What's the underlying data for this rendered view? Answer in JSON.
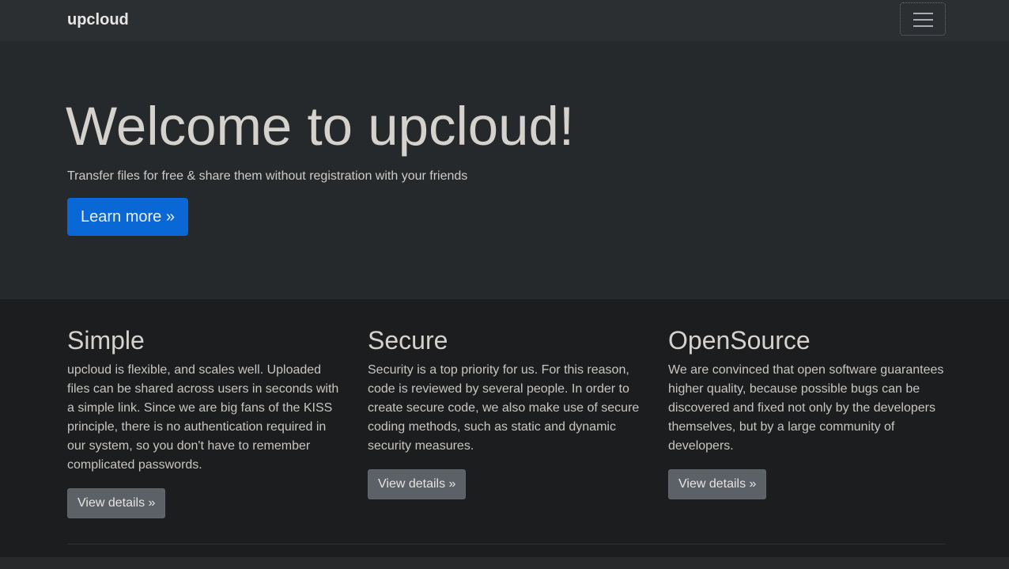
{
  "navbar": {
    "brand": "upcloud",
    "toggle_icon": "hamburger-menu-icon"
  },
  "hero": {
    "title": "Welcome to upcloud!",
    "subtitle": "Transfer files for free & share them without registration with your friends",
    "cta_label": "Learn more »"
  },
  "features": [
    {
      "title": "Simple",
      "text": "upcloud is flexible, and scales well. Uploaded files can be shared across users in seconds with a simple link. Since we are big fans of the KISS principle, there is no authentication required in our system, so you don't have to remember complicated passwords.",
      "button": "View details »"
    },
    {
      "title": "Secure",
      "text": "Security is a top priority for us. For this reason, code is reviewed by several people. In order to create secure code, we also make use of secure coding methods, such as static and dynamic security measures.",
      "button": "View details »"
    },
    {
      "title": "OpenSource",
      "text": "We are convinced that open software guarantees higher quality, because possible bugs can be discovered and fixed not only by the developers themselves, but by a large community of developers.",
      "button": "View details »"
    }
  ],
  "colors": {
    "primary": "#0a67d6",
    "secondary": "#5b6167",
    "navbar_bg": "#2c2f32",
    "hero_bg": "#26292b",
    "page_bg": "#1c1d1f"
  }
}
